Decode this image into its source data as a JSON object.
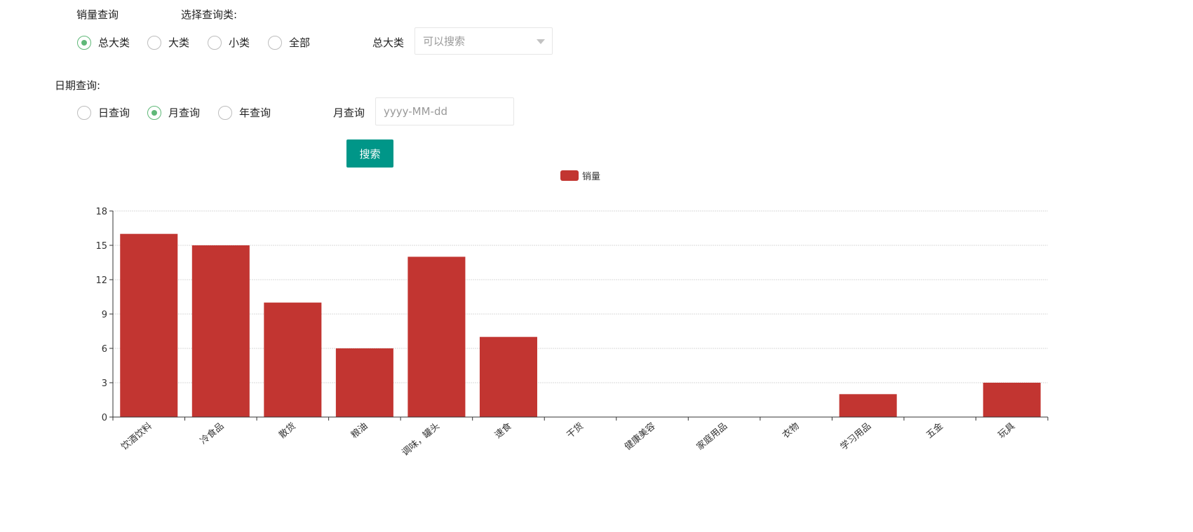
{
  "sales_query": {
    "title": "销量查询",
    "select_category_label": "选择查询类:",
    "options": [
      {
        "label": "总大类",
        "checked": true
      },
      {
        "label": "大类",
        "checked": false
      },
      {
        "label": "小类",
        "checked": false
      },
      {
        "label": "全部",
        "checked": false
      }
    ],
    "category_field_label": "总大类",
    "category_select_placeholder": "可以搜索"
  },
  "date_query": {
    "title": "日期查询:",
    "options": [
      {
        "label": "日查询",
        "checked": false
      },
      {
        "label": "月查询",
        "checked": true
      },
      {
        "label": "年查询",
        "checked": false
      }
    ],
    "field_label": "月查询",
    "input_placeholder": "yyyy-MM-dd"
  },
  "search_button_label": "搜索",
  "chart_data": {
    "type": "bar",
    "legend": "销量",
    "legend_position": "top-center",
    "bar_color": "#c23531",
    "categories": [
      "饮酒饮料",
      "冷食品",
      "散货",
      "粮油",
      "调味，罐头",
      "速食",
      "干货",
      "健康美容",
      "家庭用品",
      "衣物",
      "学习用品",
      "五金",
      "玩具"
    ],
    "series": [
      {
        "name": "销量",
        "values": [
          16,
          15,
          10,
          6,
          14,
          7,
          0,
          0,
          0,
          0,
          2,
          0,
          3
        ]
      }
    ],
    "y_ticks": [
      "0",
      "3",
      "6",
      "9",
      "12",
      "15",
      "18"
    ],
    "ylim": [
      0,
      18
    ],
    "grid": true
  }
}
